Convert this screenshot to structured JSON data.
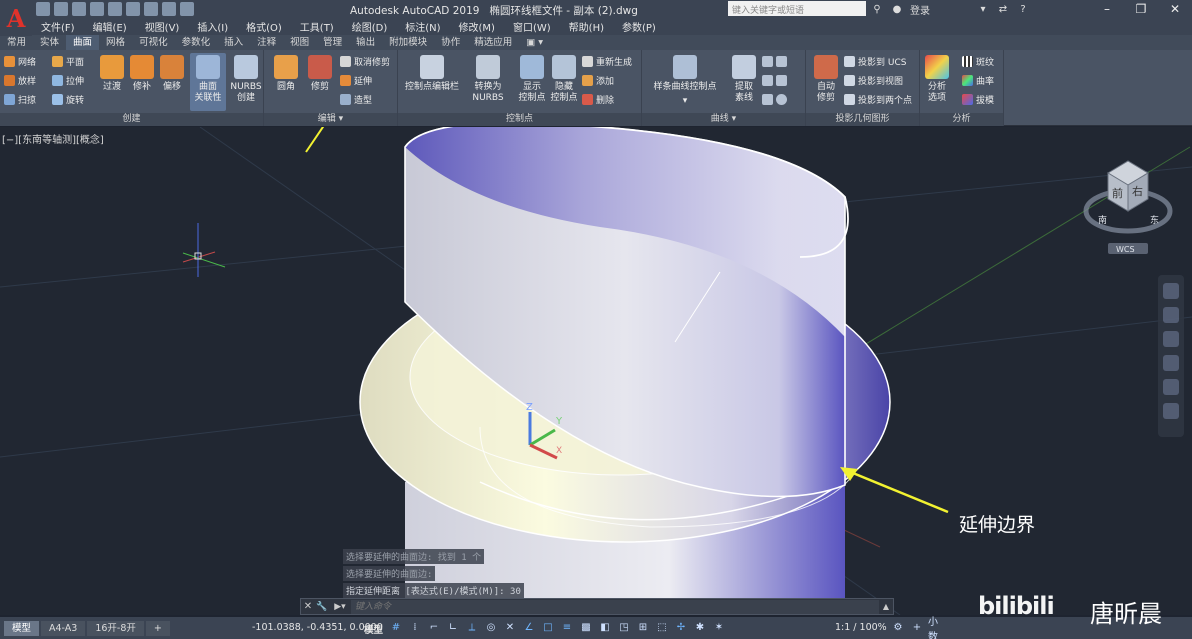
{
  "title": {
    "app": "Autodesk AutoCAD 2019",
    "file": "椭圆环线框文件 - 副本 (2).dwg",
    "search_placeholder": "键入关键字或短语",
    "login": "登录"
  },
  "menus": [
    "文件(F)",
    "编辑(E)",
    "视图(V)",
    "插入(I)",
    "格式(O)",
    "工具(T)",
    "绘图(D)",
    "标注(N)",
    "修改(M)",
    "窗口(W)",
    "帮助(H)",
    "参数(P)"
  ],
  "ribbon_tabs": [
    "常用",
    "实体",
    "曲面",
    "网格",
    "可视化",
    "参数化",
    "插入",
    "注释",
    "视图",
    "管理",
    "输出",
    "附加模块",
    "协作",
    "精选应用"
  ],
  "active_tab": "曲面",
  "panels": {
    "create": {
      "title": "创建",
      "small": [
        "网络",
        "平面",
        "放样",
        "拉伸",
        "扫掠",
        "旋转"
      ],
      "big": [
        "过渡",
        "修补",
        "偏移"
      ],
      "assoc": "曲面\n关联性",
      "assoc_l1": "曲面",
      "assoc_l2": "关联性",
      "nurbs_l1": "NURBS",
      "nurbs_l2": "创建"
    },
    "edit": {
      "title": "编辑",
      "fillet": "圆角",
      "trim": "修剪",
      "untrim": "取消修剪",
      "extend": "延伸",
      "sculpt": "造型"
    },
    "cp": {
      "title": "控制点",
      "cv_edit_bar": "控制点编辑栏",
      "convert_l1": "转换为",
      "convert_l2": "NURBS",
      "show_l1": "显示",
      "show_l2": "控制点",
      "hide_l1": "隐藏",
      "hide_l2": "控制点",
      "rebuild": "重新生成",
      "add": "添加",
      "remove": "删除"
    },
    "curves": {
      "title": "曲线",
      "spline_cv": "样条曲线控制点",
      "extract_l1": "提取",
      "extract_l2": "素线"
    },
    "project": {
      "title": "投影几何图形",
      "auto_l1": "自动",
      "auto_l2": "修剪",
      "to_ucs": "投影到 UCS",
      "to_view": "投影到视图",
      "to_2pt": "投影到两个点"
    },
    "analysis": {
      "title": "分析",
      "options_l1": "分析",
      "options_l2": "选项",
      "zebra": "斑纹",
      "curvature": "曲率",
      "draft": "拔模"
    }
  },
  "viewport": {
    "label": "[−][东南等轴测][概念]",
    "annotation": "延伸边界",
    "viewcube": {
      "top": "前",
      "side": "右",
      "n": "南",
      "e": "东",
      "wcs": "WCS"
    },
    "ucs": {
      "x": "X",
      "y": "Y",
      "z": "Z"
    }
  },
  "command": {
    "history": [
      "选择要延伸的曲面边: 找到 1 个",
      "选择要延伸的曲面边:",
      "指定延伸距离 [表达式(E)/模式(M)]: 30"
    ],
    "placeholder": "键入命令"
  },
  "status": {
    "layouts": [
      "模型",
      "A4-A3",
      "16开-8开"
    ],
    "coords": "-101.0388, -0.4351, 0.0000",
    "model": "模型",
    "scale": "1:1 / 100%",
    "scale_suffix": "小数"
  },
  "watermark": {
    "brand": "bilibili",
    "author": "唐昕晨"
  },
  "colors": {
    "accent": "#e0322b",
    "annotation": "#f2f231",
    "surface_light": "#fbf9dc",
    "surface_dark": "#5750b0"
  }
}
